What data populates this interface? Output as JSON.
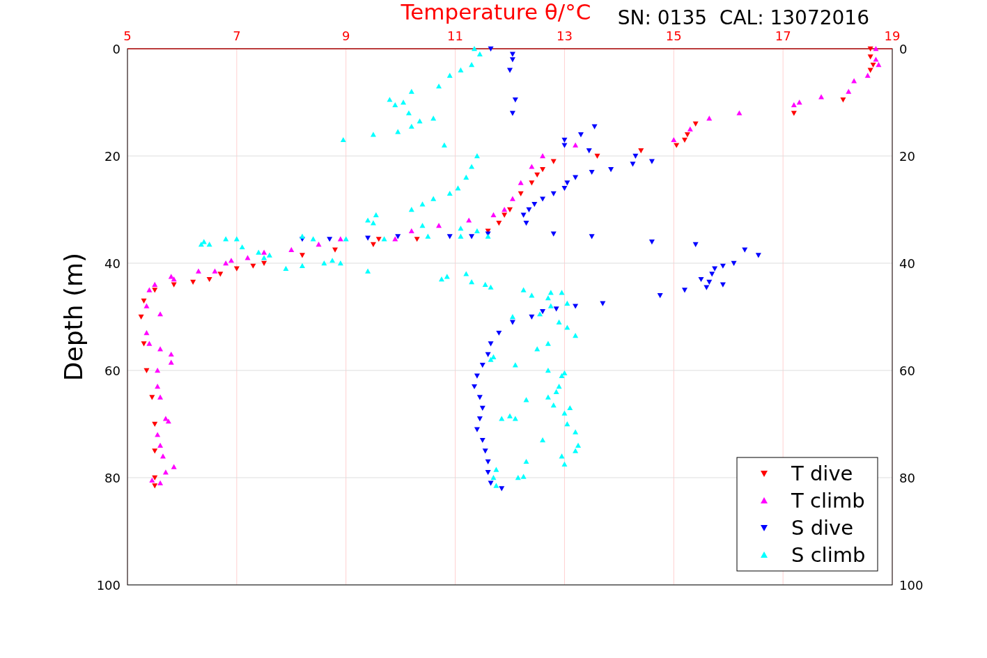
{
  "figure": {
    "annotation": "SN: 0135  CAL: 13072016",
    "chart_data": {
      "type": "scatter",
      "title": "Temperature θ/°C",
      "ylabel": "Depth (m)",
      "xlim": [
        5,
        19
      ],
      "ylim": [
        100,
        0
      ],
      "grid": true,
      "legend": true,
      "xticks": [
        {
          "value": 5,
          "label": "5"
        },
        {
          "value": 7,
          "label": "7"
        },
        {
          "value": 9,
          "label": "9"
        },
        {
          "value": 11,
          "label": "11"
        },
        {
          "value": 13,
          "label": "13"
        },
        {
          "value": 15,
          "label": "15"
        },
        {
          "value": 17,
          "label": "17"
        },
        {
          "value": 19,
          "label": "19"
        }
      ],
      "yticks": [
        {
          "value": 0,
          "label": "0"
        },
        {
          "value": 20,
          "label": "20"
        },
        {
          "value": 40,
          "label": "40"
        },
        {
          "value": 60,
          "label": "60"
        },
        {
          "value": 80,
          "label": "80"
        },
        {
          "value": 100,
          "label": "100"
        }
      ],
      "series": [
        {
          "name": "T dive",
          "color": "#ff0000",
          "marker": "triangle",
          "x": [
            18.6,
            18.6,
            18.65,
            18.6,
            18.1,
            17.2,
            15.4,
            15.25,
            15.2,
            15.05,
            14.4,
            13.6,
            12.8,
            12.6,
            12.5,
            12.4,
            12.2,
            12.0,
            11.9,
            11.8,
            11.6,
            10.3,
            9.6,
            9.5,
            8.8,
            8.2,
            7.5,
            7.3,
            7.0,
            6.7,
            6.5,
            6.2,
            5.85,
            5.5,
            5.3,
            5.25,
            5.3,
            5.35,
            5.45,
            5.5,
            5.5,
            5.5,
            5.5
          ],
          "values": [
            0,
            1.5,
            3,
            4,
            9.5,
            12,
            14,
            16,
            17,
            18,
            19,
            20,
            21,
            22.5,
            23.5,
            25,
            27,
            30,
            31,
            32.5,
            34,
            35.5,
            35.5,
            36.5,
            37.5,
            38.5,
            40,
            40.5,
            41,
            42,
            43,
            43.5,
            44,
            45,
            47,
            50,
            55,
            60,
            65,
            70,
            75,
            80,
            81.5
          ]
        },
        {
          "name": "T climb",
          "color": "#ff00ff",
          "marker": "triangle",
          "x": [
            18.7,
            18.7,
            18.75,
            18.55,
            18.3,
            18.2,
            17.7,
            17.3,
            17.2,
            16.2,
            15.65,
            15.3,
            15.0,
            13.2,
            12.6,
            12.4,
            12.2,
            12.05,
            11.9,
            11.7,
            11.25,
            10.7,
            10.2,
            9.9,
            8.9,
            8.5,
            8.0,
            7.5,
            7.2,
            6.9,
            6.8,
            6.6,
            6.3,
            5.8,
            5.85,
            5.5,
            5.4,
            5.35,
            5.6,
            5.35,
            5.4,
            5.6,
            5.8,
            5.8,
            5.55,
            5.55,
            5.6,
            5.7,
            5.75,
            5.55,
            5.6,
            5.65,
            5.85,
            5.7,
            5.45,
            5.6
          ],
          "values": [
            0,
            2,
            3,
            5,
            6,
            8,
            9,
            10,
            10.5,
            12,
            13,
            15,
            17,
            18,
            20,
            22,
            25,
            28,
            30,
            31,
            32,
            33,
            34,
            35.5,
            35.5,
            36.5,
            37.5,
            38,
            39,
            39.5,
            40,
            41.5,
            41.5,
            42.5,
            43,
            44,
            45,
            48,
            49.5,
            53,
            55,
            56,
            57,
            58.5,
            60,
            63,
            65,
            69,
            69.5,
            72,
            74,
            76,
            78,
            79,
            80.5,
            81
          ]
        },
        {
          "name": "S dive",
          "color": "#0000ff",
          "marker": "triangle",
          "x": [
            11.65,
            12.05,
            12.05,
            12.0,
            12.1,
            12.05,
            13.55,
            13.3,
            13.0,
            13.0,
            13.45,
            14.3,
            14.6,
            14.25,
            13.85,
            13.5,
            13.2,
            13.05,
            13.0,
            12.8,
            12.6,
            12.45,
            12.35,
            12.25,
            12.3,
            12.8,
            13.5,
            11.6,
            11.3,
            10.9,
            9.95,
            9.4,
            8.7,
            8.2,
            14.6,
            15.4,
            16.3,
            16.55,
            16.1,
            15.9,
            15.75,
            15.7,
            15.5,
            15.65,
            15.9,
            15.6,
            15.2,
            14.75,
            13.7,
            13.2,
            12.85,
            12.6,
            12.4,
            12.05,
            11.8,
            11.65,
            11.6,
            11.5,
            11.4,
            11.35,
            11.45,
            11.5,
            11.45,
            11.4,
            11.5,
            11.55,
            11.6,
            11.6,
            11.65,
            11.85
          ],
          "values": [
            0,
            1,
            2,
            4,
            9.5,
            12,
            14.5,
            16,
            17,
            18,
            19,
            20,
            21,
            21.5,
            22.5,
            23,
            24,
            25,
            26,
            27,
            28,
            29,
            30,
            31,
            32.5,
            34.5,
            35,
            34.5,
            35,
            35,
            35,
            35.3,
            35.5,
            35.5,
            36,
            36.5,
            37.5,
            38.5,
            40,
            40.5,
            41,
            42,
            43,
            43.5,
            44,
            44.5,
            45,
            46,
            47.5,
            48,
            48.5,
            49,
            50,
            51,
            53,
            55,
            57,
            59,
            61,
            63,
            65,
            67,
            69,
            71,
            73,
            75,
            77,
            79,
            81,
            82
          ]
        },
        {
          "name": "S climb",
          "color": "#00ffff",
          "marker": "triangle",
          "x": [
            11.35,
            11.45,
            11.3,
            11.1,
            10.9,
            10.7,
            10.2,
            9.8,
            10.05,
            9.9,
            10.15,
            10.6,
            10.35,
            10.2,
            9.95,
            9.5,
            8.95,
            10.8,
            11.4,
            11.3,
            11.2,
            11.05,
            10.9,
            10.6,
            10.4,
            10.2,
            9.55,
            9.4,
            9.5,
            10.4,
            11.1,
            11.4,
            11.6,
            11.1,
            10.5,
            9.7,
            9.0,
            8.4,
            8.2,
            7.0,
            6.8,
            6.4,
            6.5,
            6.35,
            7.1,
            7.4,
            7.6,
            7.5,
            7.9,
            8.2,
            8.6,
            8.75,
            8.9,
            9.4,
            10.75,
            10.85,
            11.2,
            11.3,
            11.55,
            11.65,
            12.25,
            12.4,
            12.7,
            12.75,
            12.95,
            13.05,
            12.75,
            12.55,
            12.05,
            12.9,
            13.05,
            13.2,
            12.7,
            12.5,
            11.7,
            11.65,
            12.1,
            12.7,
            13.0,
            12.95,
            12.9,
            12.85,
            12.7,
            12.3,
            12.8,
            13.1,
            13.0,
            12.0,
            11.85,
            12.1,
            13.05,
            13.2,
            12.6,
            13.25,
            13.2,
            12.95,
            12.3,
            13.0,
            11.75,
            11.7,
            12.15,
            12.25,
            11.75
          ],
          "values": [
            0,
            1,
            3,
            4,
            5,
            7,
            8,
            9.5,
            10,
            10.5,
            12,
            13,
            13.5,
            14.5,
            15.5,
            16,
            17,
            18,
            20,
            22,
            24,
            26,
            27,
            28,
            29,
            30,
            31,
            32,
            32.5,
            33,
            33.5,
            34,
            35,
            35,
            35,
            35.5,
            35.5,
            35.5,
            35,
            35.5,
            35.5,
            36,
            36.5,
            36.5,
            37,
            38,
            38.5,
            39,
            41,
            40.5,
            40,
            39.5,
            40,
            41.5,
            43,
            42.5,
            42,
            43.5,
            44,
            44.5,
            45,
            46,
            46.5,
            45.5,
            45.5,
            47.5,
            48,
            49.5,
            50,
            51,
            52,
            53.5,
            55,
            56,
            57.5,
            58,
            59,
            60,
            60.5,
            61,
            63,
            64,
            65,
            65.5,
            66.5,
            67,
            68,
            68.5,
            69,
            69,
            70,
            71.5,
            73,
            74,
            75,
            76,
            77,
            77.5,
            78.5,
            80,
            80,
            79.8,
            81.5
          ]
        }
      ]
    }
  }
}
